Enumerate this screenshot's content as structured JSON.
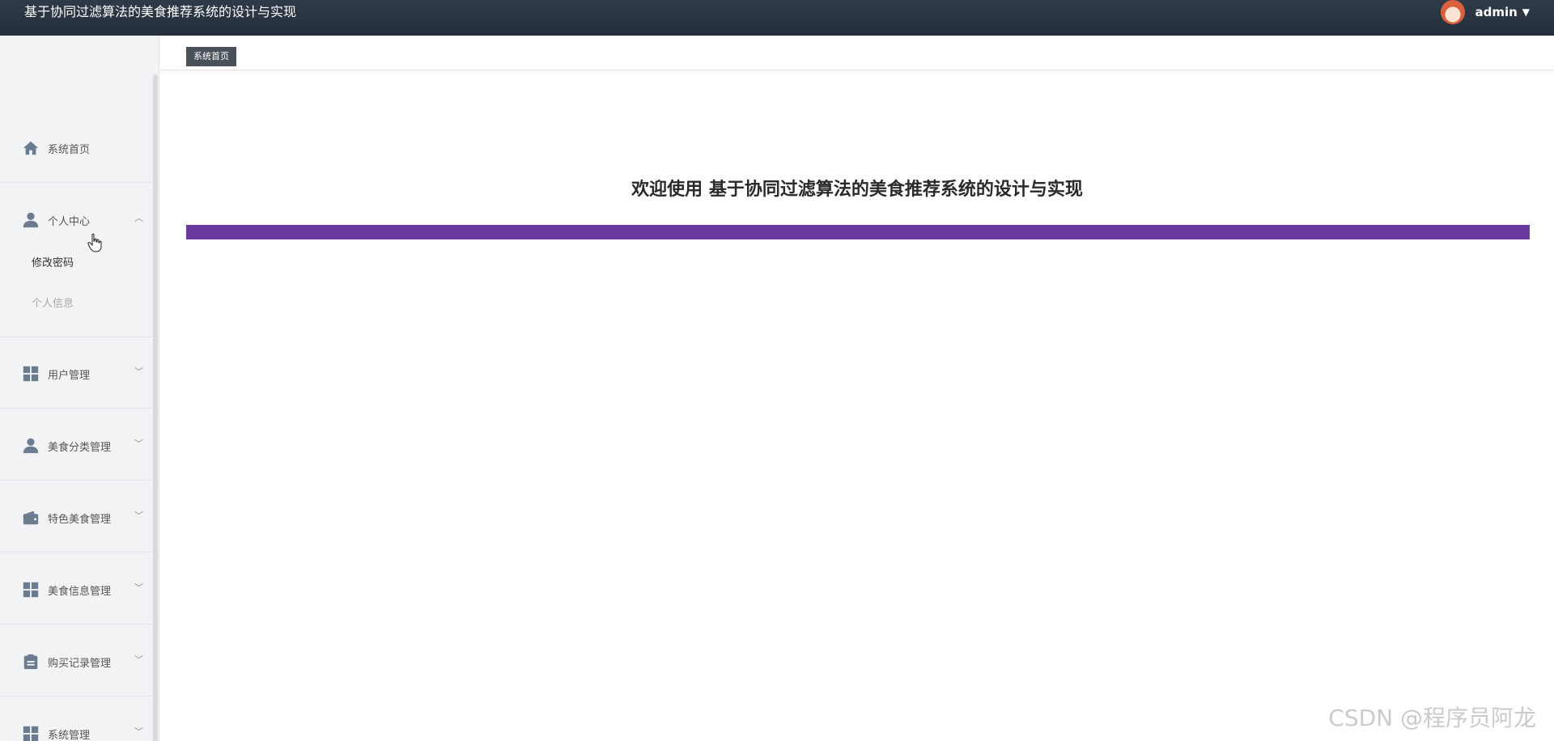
{
  "header": {
    "app_title": "基于协同过滤算法的美食推荐系统的设计与实现",
    "username": "admin",
    "user_menu_icon": "caret-down-icon",
    "avatar_icon": "avatar"
  },
  "sidebar": {
    "items": [
      {
        "label": "系统首页",
        "icon": "home-icon",
        "chevron": ""
      },
      {
        "label": "个人中心",
        "icon": "user-icon",
        "chevron": "up"
      },
      {
        "label": "用户管理",
        "icon": "grid-icon",
        "chevron": "down"
      },
      {
        "label": "美食分类管理",
        "icon": "user-icon",
        "chevron": "down"
      },
      {
        "label": "特色美食管理",
        "icon": "wallet-icon",
        "chevron": "down"
      },
      {
        "label": "美食信息管理",
        "icon": "grid-icon",
        "chevron": "down"
      },
      {
        "label": "购买记录管理",
        "icon": "clipboard-icon",
        "chevron": "down"
      },
      {
        "label": "系统管理",
        "icon": "grid-icon",
        "chevron": "down"
      }
    ],
    "submenu": [
      {
        "label": "修改密码",
        "state": "hover"
      },
      {
        "label": "个人信息",
        "state": "normal"
      }
    ]
  },
  "tabs": [
    {
      "label": "系统首页",
      "active": true
    }
  ],
  "main": {
    "welcome_text": "欢迎使用 基于协同过滤算法的美食推荐系统的设计与实现"
  },
  "watermark": "CSDN @程序员阿龙",
  "colors": {
    "topbar": "#2b3542",
    "accent_bar": "#6b3aa0",
    "sidebar_bg": "#f2f3f5",
    "icon": "#6b7b90",
    "tab_bg": "#4a5058"
  }
}
